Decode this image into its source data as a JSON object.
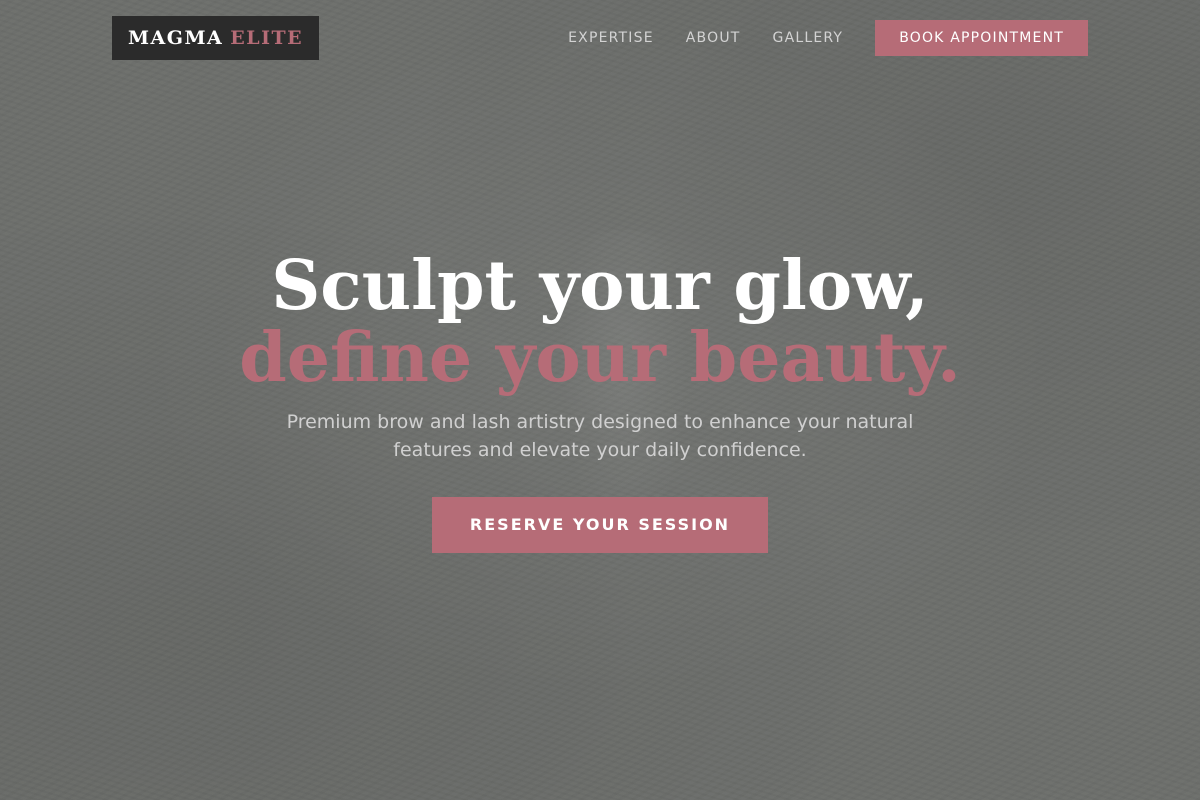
{
  "brand": {
    "name": "MAGMA",
    "accent": "ELITE"
  },
  "nav": {
    "links": [
      "EXPERTISE",
      "ABOUT",
      "GALLERY"
    ],
    "cta_label": "BOOK APPOINTMENT"
  },
  "hero": {
    "headline_line1": "Sculpt your glow,",
    "headline_line2": "define your beauty.",
    "subtitle": "Premium brow and lash artistry designed to enhance your natural features and elevate your daily confidence.",
    "cta_label": "RESERVE YOUR SESSION"
  },
  "colors": {
    "accent": "#b66c77",
    "background": "#6c6e6b",
    "logo_background": "#2b2b2b"
  }
}
